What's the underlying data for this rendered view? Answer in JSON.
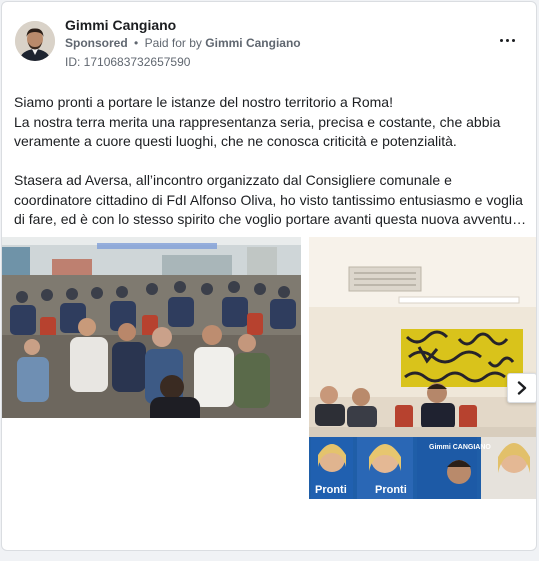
{
  "post": {
    "author_name": "Gimmi Cangiano",
    "sponsored_label": "Sponsored",
    "separator": "•",
    "paid_for_prefix": "Paid for by",
    "paid_for_name": "Gimmi Cangiano",
    "ad_id": "ID: 1710683732657590",
    "body_lines": [
      "Siamo pronti a portare le istanze del nostro territorio a Roma!",
      "La nostra terra merita una rappresentanza seria, precisa e costante, che abbia",
      "veramente a cuore questi luoghi, che ne conosca criticità e potenzialità.",
      "",
      "Stasera ad Aversa, all’incontro organizzato dal Consigliere comunale e",
      "coordinatore cittadino di FdI Alfonso Oliva, ho visto tantissimo entusiasmo e voglia",
      "di fare, ed è con lo stesso spirito che voglio portare avanti questa nuova avventur…"
    ],
    "poster_brand": "Gimmi CANGIANO",
    "poster_slogan": "Pronti"
  },
  "icons": {
    "more": "more-horizontal-icon",
    "next": "chevron-right-icon"
  },
  "colors": {
    "text_primary": "#1c1e21",
    "text_secondary": "#606770",
    "card_border": "#dadde1",
    "page_bg": "#f0f2f5"
  }
}
